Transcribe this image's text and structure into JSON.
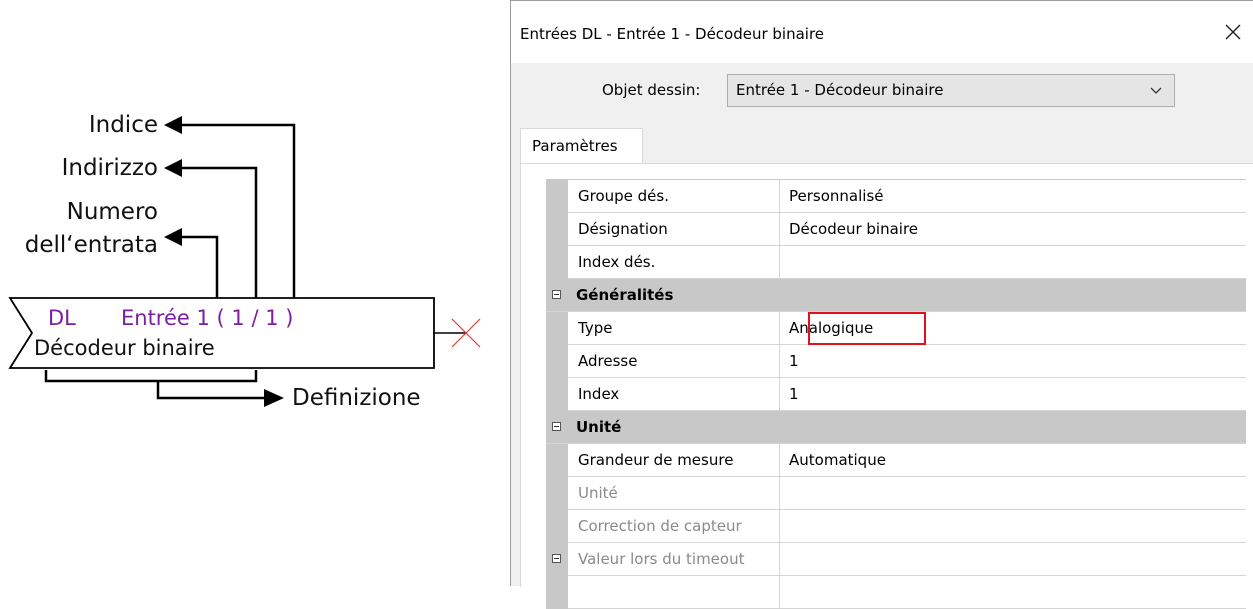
{
  "diagram": {
    "labels": {
      "indice": "Indice",
      "indirizzo": "Indirizzo",
      "numero_line1": "Numero",
      "numero_line2": "dell‘entrata",
      "definizione": "Definizione"
    },
    "block": {
      "prefix": "DL",
      "input": "Entrée 1 ( 1 / 1 )",
      "name": "Décodeur binaire"
    },
    "colors": {
      "accent_purple": "#7b1fa2",
      "x_mark": "#e53935"
    }
  },
  "dialog": {
    "title": "Entrées DL - Entrée 1 - Décodeur binaire",
    "object_label": "Objet dessin:",
    "object_value": "Entrée 1 - Décodeur binaire",
    "tab": "Paramètres",
    "rows": [
      {
        "name": "Groupe dés.",
        "value": "Personnalisé"
      },
      {
        "name": "Désignation",
        "value": "Décodeur binaire"
      },
      {
        "name": "Index dés.",
        "value": ""
      },
      {
        "category": "Généralités"
      },
      {
        "name": "Type",
        "value": "Analogique"
      },
      {
        "name": "Adresse",
        "value": "1"
      },
      {
        "name": "Index",
        "value": "1"
      },
      {
        "category": "Unité"
      },
      {
        "name": "Grandeur de mesure",
        "value": "Automatique"
      },
      {
        "name": "Unité",
        "value": ""
      },
      {
        "name": "Correction de capteur",
        "value": ""
      },
      {
        "name": "Valeur lors du timeout",
        "value": ""
      }
    ],
    "highlight_color": "#e0101c"
  }
}
